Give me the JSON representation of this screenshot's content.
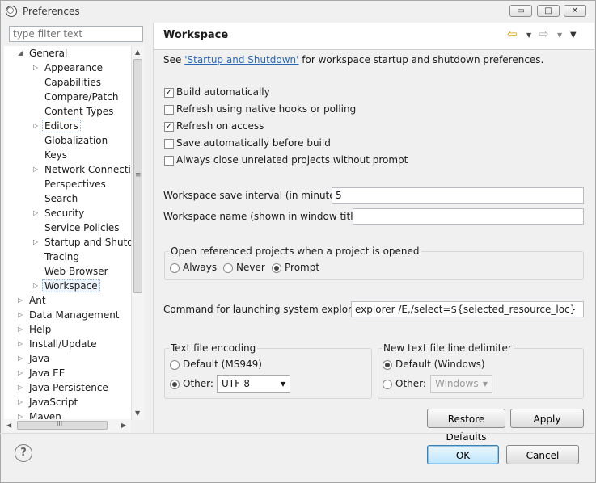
{
  "window": {
    "title": "Preferences",
    "caption_minimize": "▭",
    "caption_maximize": "□",
    "caption_close": "✕"
  },
  "filter": {
    "placeholder": "type filter text"
  },
  "tree": {
    "general": "General",
    "children": [
      "Appearance",
      "Capabilities",
      "Compare/Patch",
      "Content Types",
      "Editors",
      "Globalization",
      "Keys",
      "Network Connectio",
      "Perspectives",
      "Search",
      "Security",
      "Service Policies",
      "Startup and Shutdo",
      "Tracing",
      "Web Browser",
      "Workspace"
    ],
    "top": [
      "Ant",
      "Data Management",
      "Help",
      "Install/Update",
      "Java",
      "Java EE",
      "Java Persistence",
      "JavaScript",
      "Maven"
    ],
    "vscroll_grip": "≡",
    "hscroll_grip": "III"
  },
  "page": {
    "title": "Workspace",
    "desc_prefix": "See ",
    "desc_link": "'Startup and Shutdown'",
    "desc_suffix": " for workspace startup and shutdown preferences.",
    "options": [
      {
        "label": "Build automatically",
        "checked": true
      },
      {
        "label": "Refresh using native hooks or polling",
        "checked": false
      },
      {
        "label": "Refresh on access",
        "checked": true
      },
      {
        "label": "Save automatically before build",
        "checked": false
      },
      {
        "label": "Always close unrelated projects without prompt",
        "checked": false
      }
    ],
    "save_interval_label": "Workspace save interval (in minutes):",
    "save_interval_value": "5",
    "ws_name_label": "Workspace name (shown in window title):",
    "ws_name_value": "",
    "open_ref_group": "Open referenced projects when a project is opened",
    "open_ref_always": "Always",
    "open_ref_never": "Never",
    "open_ref_prompt": "Prompt",
    "open_ref_selected": "Prompt",
    "explorer_label": "Command for launching system explorer:",
    "explorer_value": "explorer /E,/select=${selected_resource_loc}",
    "encoding_group": "Text file encoding",
    "encoding_default": "Default (MS949)",
    "encoding_other": "Other:",
    "encoding_value": "UTF-8",
    "delimiter_group": "New text file line delimiter",
    "delimiter_default": "Default (Windows)",
    "delimiter_other": "Other:",
    "delimiter_value": "Windows",
    "restore_defaults": "Restore Defaults",
    "apply": "Apply"
  },
  "dialog": {
    "help": "?",
    "ok": "OK",
    "cancel": "Cancel"
  },
  "colors": {
    "link": "#2a67b6",
    "default_button": "#3c7fb1",
    "nav_back": "#d8a200"
  }
}
